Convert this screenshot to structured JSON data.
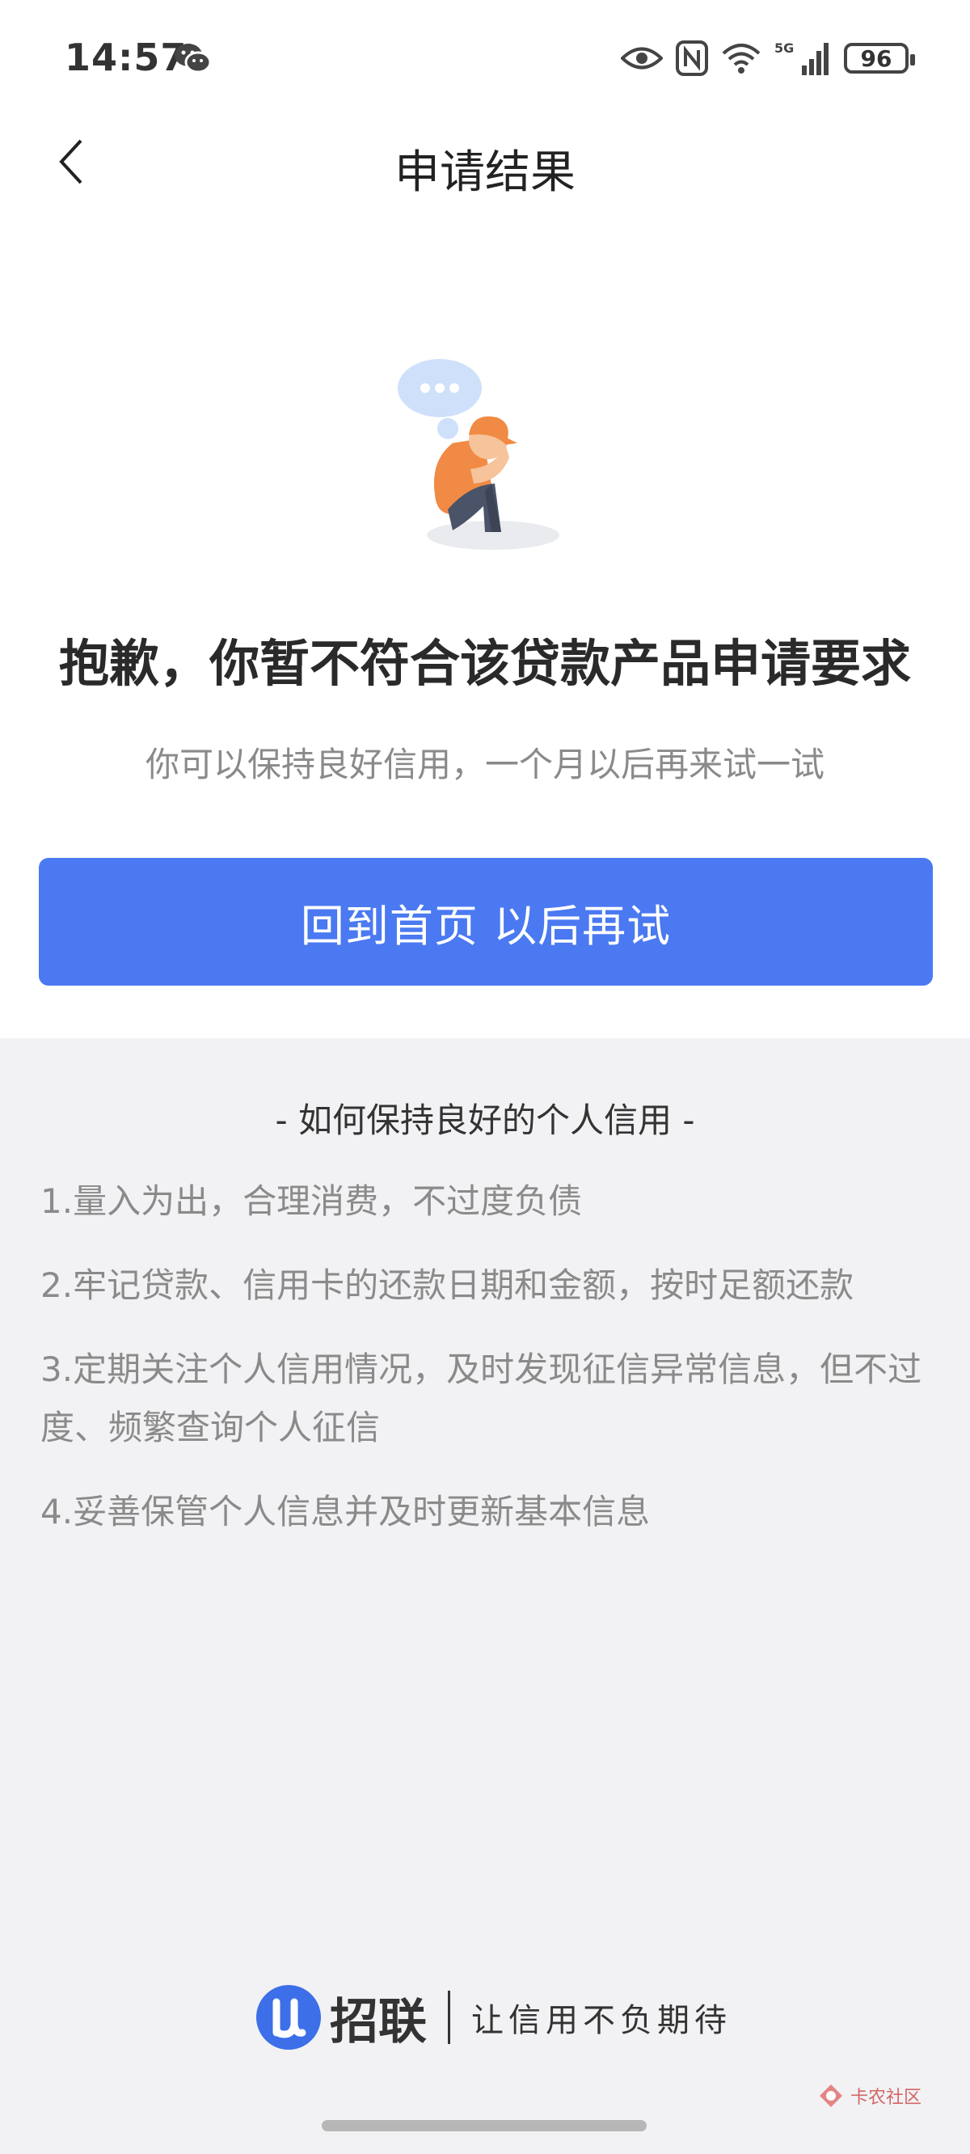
{
  "status_bar": {
    "time": "14:57",
    "battery": "96",
    "network": "5G"
  },
  "nav": {
    "title": "申请结果"
  },
  "result": {
    "headline": "抱歉，你暂不符合该贷款产品申请要求",
    "subtext": "你可以保持良好信用，一个月以后再来试一试",
    "button_label": "回到首页 以后再试"
  },
  "tips": {
    "title": "- 如何保持良好的个人信用 -",
    "items": [
      "1.量入为出，合理消费，不过度负债",
      "2.牢记贷款、信用卡的还款日期和金额，按时足额还款",
      "3.定期关注个人信用情况，及时发现征信异常信息，但不过度、频繁查询个人征信",
      "4.妥善保管个人信息并及时更新基本信息"
    ]
  },
  "footer": {
    "brand_name": "招联",
    "slogan": "让信用不负期待"
  },
  "watermark": {
    "text": "卡农社区"
  },
  "colors": {
    "primary": "#4a79f1",
    "background": "#f2f2f4"
  }
}
